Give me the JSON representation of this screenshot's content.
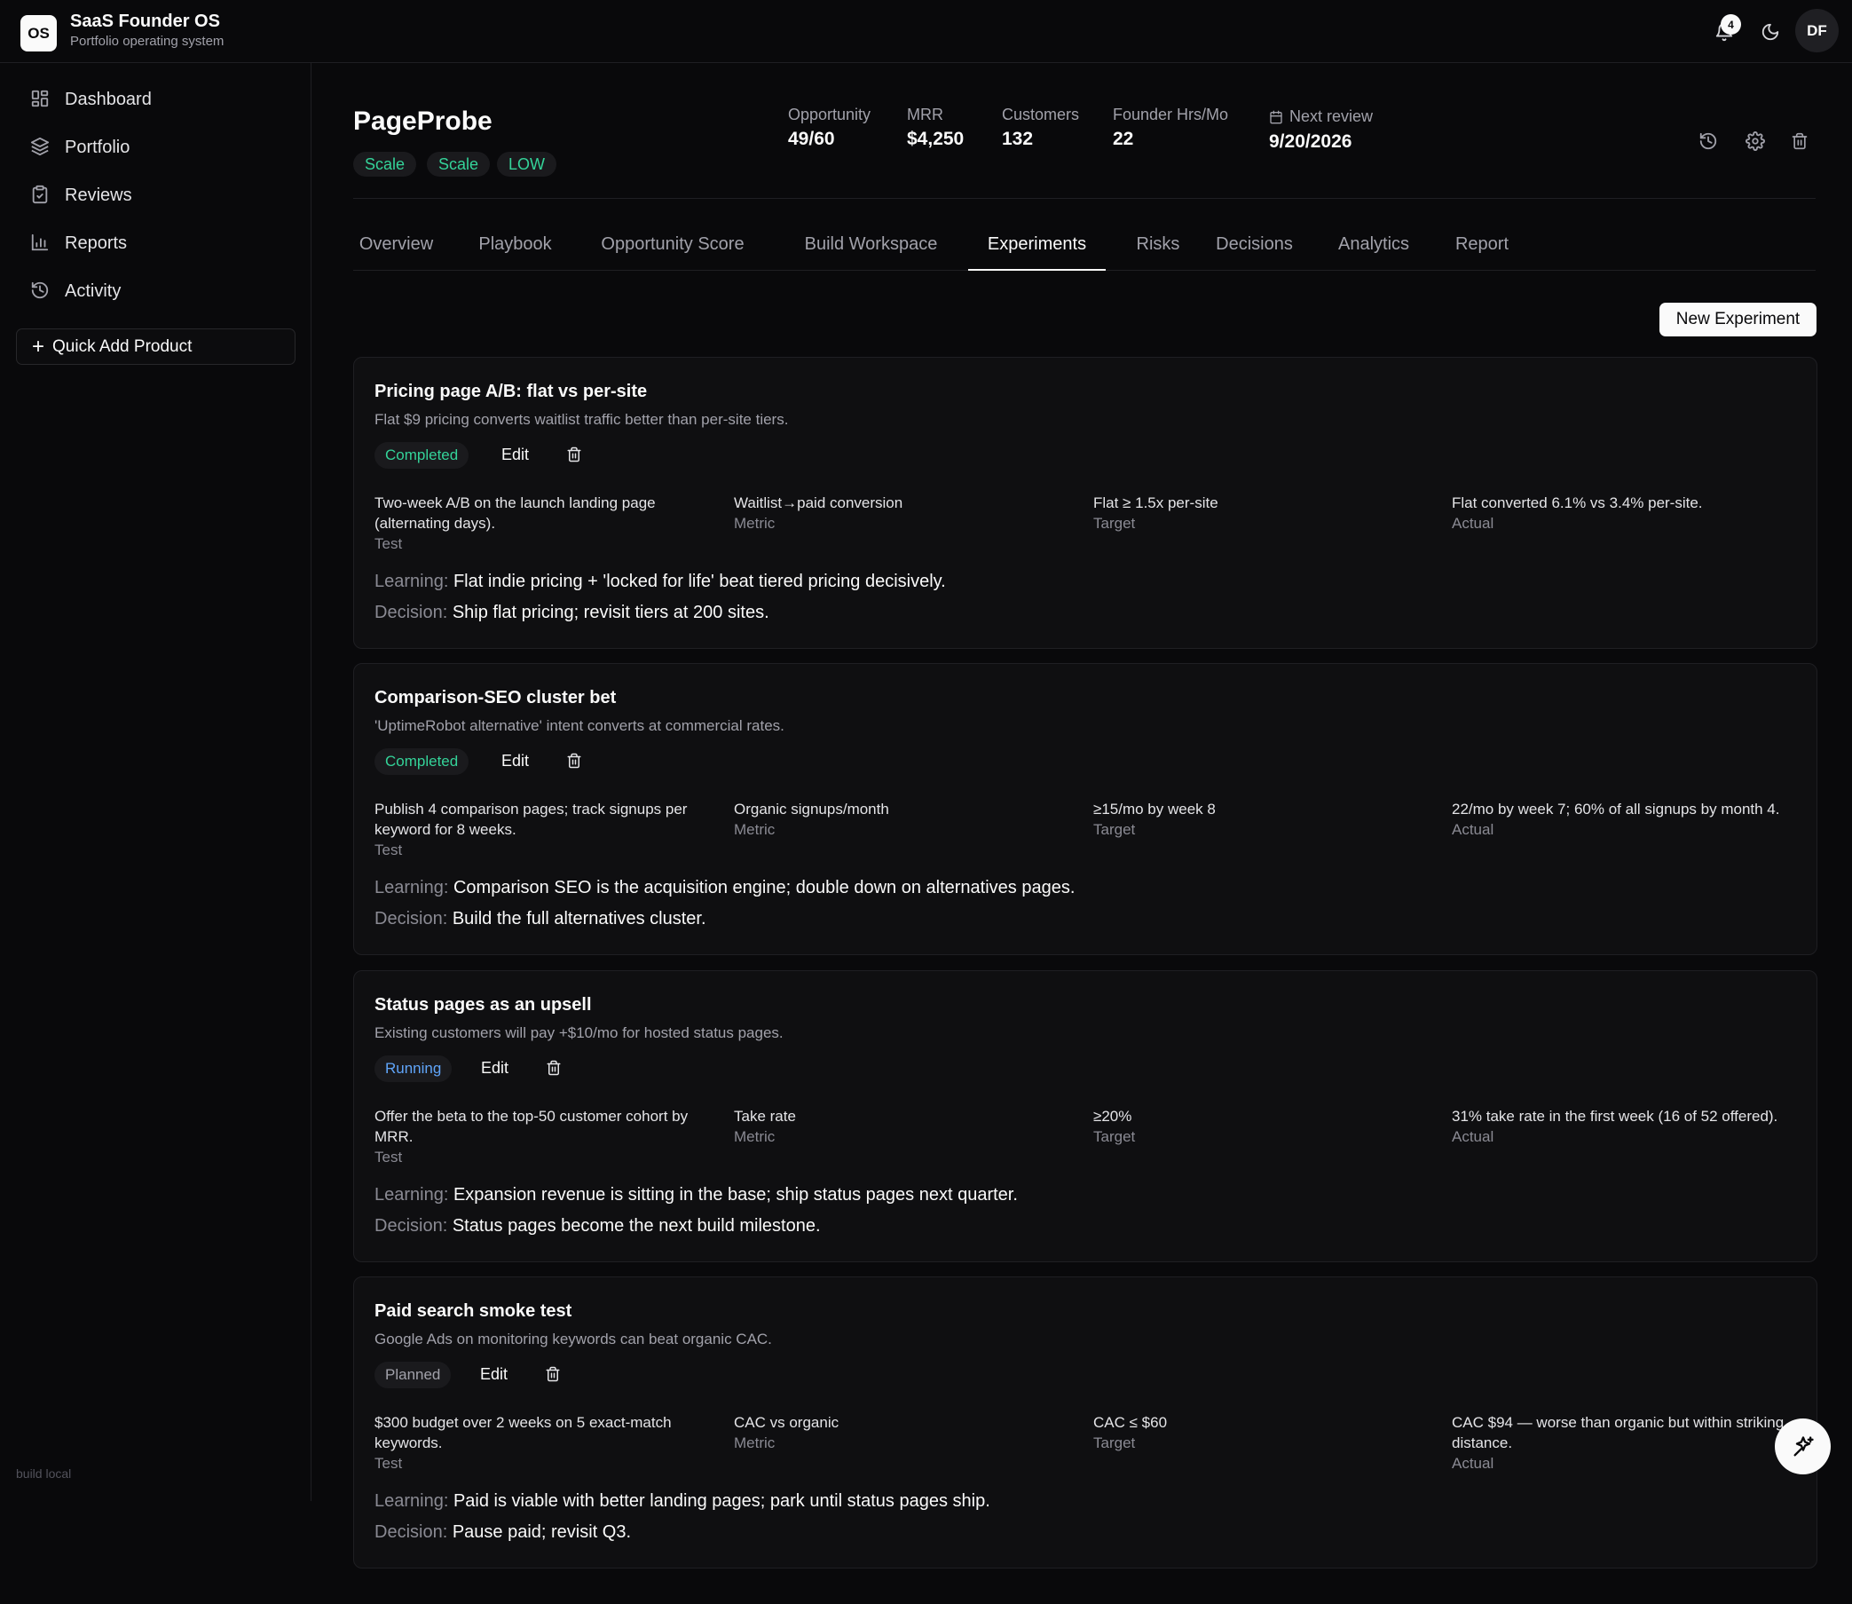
{
  "app": {
    "logo": "OS",
    "title": "SaaS Founder OS",
    "subtitle": "Portfolio operating system",
    "notification_count": "4",
    "avatar_initials": "DF"
  },
  "sidebar": {
    "items": [
      {
        "label": "Dashboard",
        "icon": "grid-icon"
      },
      {
        "label": "Portfolio",
        "icon": "layers-icon"
      },
      {
        "label": "Reviews",
        "icon": "clipboard-check-icon"
      },
      {
        "label": "Reports",
        "icon": "bar-chart-icon"
      },
      {
        "label": "Activity",
        "icon": "history-icon"
      }
    ],
    "quick_add": "Quick Add Product",
    "build": "build local"
  },
  "product": {
    "name": "PageProbe",
    "tags": [
      "Scale",
      "Scale",
      "LOW"
    ],
    "metrics": [
      {
        "label": "Opportunity",
        "value": "49/60"
      },
      {
        "label": "MRR",
        "value": "$4,250"
      },
      {
        "label": "Customers",
        "value": "132"
      },
      {
        "label": "Founder Hrs/Mo",
        "value": "22"
      }
    ],
    "next_review_label": "Next review",
    "next_review_value": "9/20/2026"
  },
  "tabs": [
    "Overview",
    "Playbook",
    "Opportunity Score",
    "Build Workspace",
    "Experiments",
    "Risks",
    "Decisions",
    "Analytics",
    "Report"
  ],
  "active_tab": "Experiments",
  "new_experiment_label": "New Experiment",
  "labels": {
    "edit": "Edit",
    "test": "Test",
    "metric": "Metric",
    "target": "Target",
    "actual": "Actual",
    "learning": "Learning:",
    "decision": "Decision:"
  },
  "experiments": [
    {
      "title": "Pricing page A/B: flat vs per-site",
      "hypothesis": "Flat $9 pricing converts waitlist traffic better than per-site tiers.",
      "status": "Completed",
      "test": "Two-week A/B on the launch landing page (alternating days).",
      "metric": "Waitlist→paid conversion",
      "target": "Flat ≥ 1.5x per-site",
      "actual": "Flat converted 6.1% vs 3.4% per-site.",
      "learning": "Flat indie pricing + 'locked for life' beat tiered pricing decisively.",
      "decision": "Ship flat pricing; revisit tiers at 200 sites."
    },
    {
      "title": "Comparison-SEO cluster bet",
      "hypothesis": "'UptimeRobot alternative' intent converts at commercial rates.",
      "status": "Completed",
      "test": "Publish 4 comparison pages; track signups per keyword for 8 weeks.",
      "metric": "Organic signups/month",
      "target": "≥15/mo by week 8",
      "actual": "22/mo by week 7; 60% of all signups by month 4.",
      "learning": "Comparison SEO is the acquisition engine; double down on alternatives pages.",
      "decision": "Build the full alternatives cluster."
    },
    {
      "title": "Status pages as an upsell",
      "hypothesis": "Existing customers will pay +$10/mo for hosted status pages.",
      "status": "Running",
      "test": "Offer the beta to the top-50 customer cohort by MRR.",
      "metric": "Take rate",
      "target": "≥20%",
      "actual": "31% take rate in the first week (16 of 52 offered).",
      "learning": "Expansion revenue is sitting in the base; ship status pages next quarter.",
      "decision": "Status pages become the next build milestone."
    },
    {
      "title": "Paid search smoke test",
      "hypothesis": "Google Ads on monitoring keywords can beat organic CAC.",
      "status": "Planned",
      "test": "$300 budget over 2 weeks on 5 exact-match keywords.",
      "metric": "CAC vs organic",
      "target": "CAC ≤ $60",
      "actual": "CAC $94 — worse than organic but within striking distance.",
      "learning": "Paid is viable with better landing pages; park until status pages ship.",
      "decision": "Pause paid; revisit Q3."
    }
  ],
  "colors": {
    "background": "#09090b",
    "completed": "#34d399",
    "running": "#60a5fa",
    "planned": "#a1a1aa"
  },
  "fab_icon": "sparkles-icon"
}
